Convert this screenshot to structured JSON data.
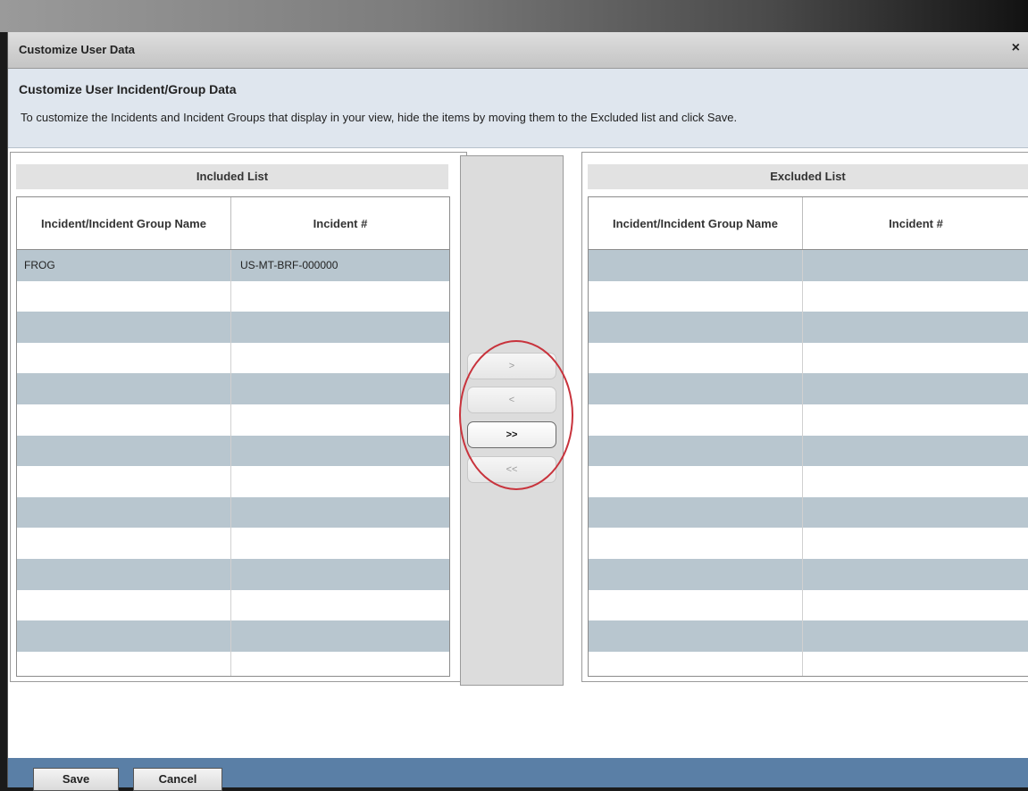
{
  "dialog": {
    "title": "Customize User Data",
    "close_symbol": "×"
  },
  "info": {
    "heading": "Customize User Incident/Group Data",
    "description": "To customize the Incidents and Incident Groups that display in your view, hide the items by moving them to the Excluded list and click Save."
  },
  "included": {
    "title": "Included List",
    "columns": [
      "Incident/Incident Group Name",
      "Incident #"
    ],
    "rows": [
      [
        "FROG",
        "US-MT-BRF-000000"
      ],
      [
        "",
        ""
      ],
      [
        "",
        ""
      ],
      [
        "",
        ""
      ],
      [
        "",
        ""
      ],
      [
        "",
        ""
      ],
      [
        "",
        ""
      ],
      [
        "",
        ""
      ],
      [
        "",
        ""
      ],
      [
        "",
        ""
      ],
      [
        "",
        ""
      ],
      [
        "",
        ""
      ],
      [
        "",
        ""
      ],
      [
        "",
        ""
      ]
    ]
  },
  "excluded": {
    "title": "Excluded List",
    "columns": [
      "Incident/Incident Group Name",
      "Incident #"
    ],
    "rows": [
      [
        "",
        ""
      ],
      [
        "",
        ""
      ],
      [
        "",
        ""
      ],
      [
        "",
        ""
      ],
      [
        "",
        ""
      ],
      [
        "",
        ""
      ],
      [
        "",
        ""
      ],
      [
        "",
        ""
      ],
      [
        "",
        ""
      ],
      [
        "",
        ""
      ],
      [
        "",
        ""
      ],
      [
        "",
        ""
      ],
      [
        "",
        ""
      ],
      [
        "",
        ""
      ]
    ]
  },
  "move_buttons": {
    "move_right": ">",
    "move_left": "<",
    "move_all_right": ">>",
    "move_all_left": "<<"
  },
  "footer": {
    "save_label": "Save",
    "cancel_label": "Cancel"
  },
  "colors": {
    "row_stripe": "#b8c6cf",
    "footer_bar": "#5a7fa6",
    "highlight_ring": "#c8333c",
    "info_background": "#dfe6ee"
  }
}
